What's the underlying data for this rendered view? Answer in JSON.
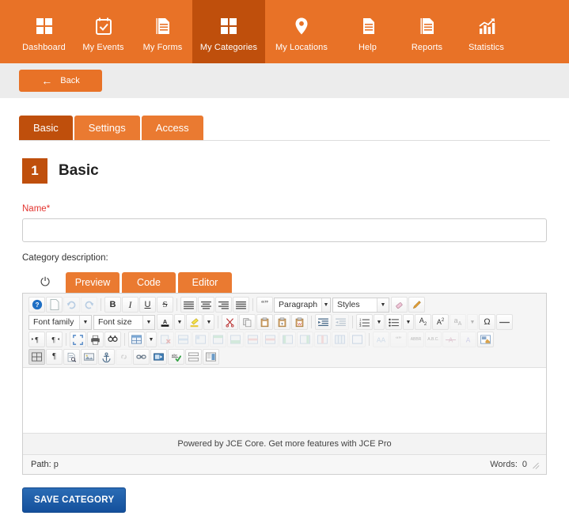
{
  "nav": {
    "items": [
      {
        "label": "Dashboard",
        "icon": "grid-icon",
        "active": false
      },
      {
        "label": "My Events",
        "icon": "calendar-check-icon",
        "active": false
      },
      {
        "label": "My Forms",
        "icon": "document-lines-icon",
        "active": false
      },
      {
        "label": "My Categories",
        "icon": "grid-icon",
        "active": true
      },
      {
        "label": "My Locations",
        "icon": "map-pin-icon",
        "active": false
      },
      {
        "label": "Help",
        "icon": "document-lines-icon",
        "active": false
      },
      {
        "label": "Reports",
        "icon": "document-lines-icon",
        "active": false
      },
      {
        "label": "Statistics",
        "icon": "chart-arrow-icon",
        "active": false
      }
    ],
    "colors": {
      "bar": "#e87227",
      "active": "#bf4f0c",
      "text": "#ffffff"
    }
  },
  "toolbar": {
    "back_label": "Back",
    "back_icon": "arrow-left-icon"
  },
  "tabs": [
    {
      "label": "Basic",
      "active": true
    },
    {
      "label": "Settings",
      "active": false
    },
    {
      "label": "Access",
      "active": false
    }
  ],
  "section": {
    "step": "1",
    "title": "Basic"
  },
  "form": {
    "name_label": "Name",
    "name_required_marker": "*",
    "name_value": "",
    "name_placeholder": "",
    "description_label": "Category description:"
  },
  "editor": {
    "power_icon": "power-icon",
    "tabs": [
      {
        "label": "Preview",
        "active": false
      },
      {
        "label": "Code",
        "active": false
      },
      {
        "label": "Editor",
        "active": true
      }
    ],
    "selects": {
      "paragraph": "Paragraph",
      "styles": "Styles",
      "font_family": "Font family",
      "font_size": "Font size"
    },
    "content": "",
    "promo": "Powered by JCE Core. Get more features with JCE Pro",
    "path_label": "Path:",
    "path_value": "p",
    "words_label": "Words:",
    "words_value": "0"
  },
  "actions": {
    "save_label": "SAVE CATEGORY",
    "save_color": "#14509c"
  }
}
